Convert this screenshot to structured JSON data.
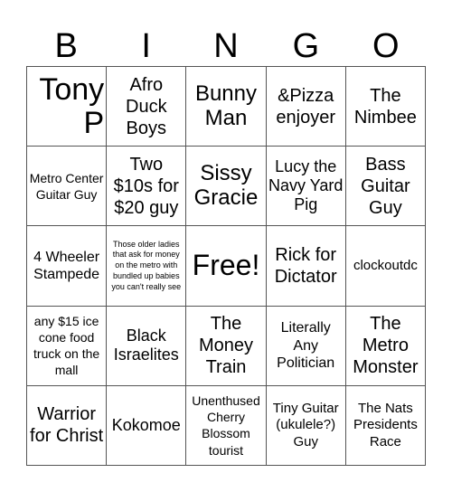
{
  "header": {
    "letters": [
      "B",
      "I",
      "N",
      "G",
      "O"
    ]
  },
  "board": {
    "cells": [
      [
        "Tony P",
        "Afro Duck Boys",
        "Bunny Man",
        "&Pizza enjoyer",
        "The Nimbee"
      ],
      [
        "Metro Center Guitar Guy",
        "Two $10s for $20 guy",
        "Sissy Gracie",
        "Lucy the Navy Yard Pig",
        "Bass Guitar Guy"
      ],
      [
        "4 Wheeler Stampede",
        "Those older ladies that ask for money on the metro with bundled up babies you can't really see",
        "Free!",
        "Rick for Dictator",
        "clockoutdc"
      ],
      [
        "any $15 ice cone food truck on the mall",
        "Black Israelites",
        "The Money Train",
        "Literally Any Politician",
        "The Metro Monster"
      ],
      [
        "Warrior for Christ",
        "Kokomoe",
        "Unenthused Cherry Blossom tourist",
        "Tiny Guitar (ukulele?) Guy",
        "The Nats Presidents Race"
      ]
    ]
  }
}
